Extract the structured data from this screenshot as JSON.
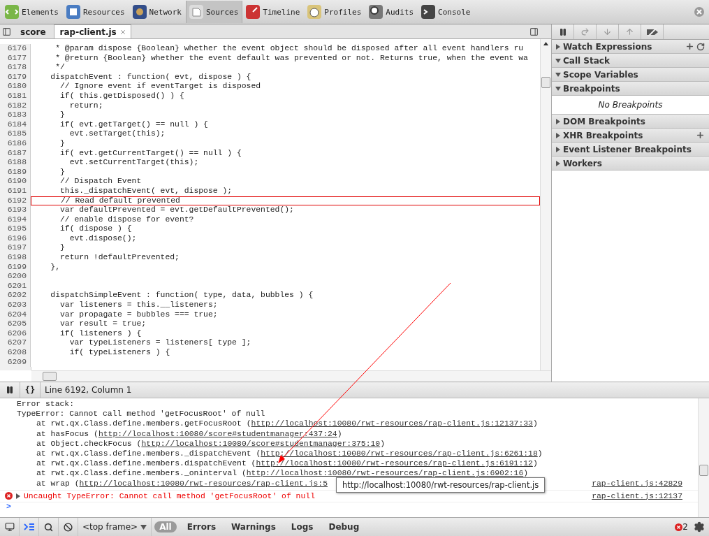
{
  "toolbar": {
    "tabs": [
      {
        "label": "Elements",
        "selected": false
      },
      {
        "label": "Resources",
        "selected": false
      },
      {
        "label": "Network",
        "selected": false
      },
      {
        "label": "Sources",
        "selected": true
      },
      {
        "label": "Timeline",
        "selected": false
      },
      {
        "label": "Profiles",
        "selected": false
      },
      {
        "label": "Audits",
        "selected": false
      },
      {
        "label": "Console",
        "selected": false
      }
    ]
  },
  "editor": {
    "file_tabs": [
      {
        "label": "score",
        "selected": false
      },
      {
        "label": "rap-client.js",
        "selected": true
      }
    ],
    "lines": [
      {
        "number": "6176",
        "text": "     * @param dispose {Boolean} whether the event object should be disposed after all event handlers ru",
        "highlighted": false
      },
      {
        "number": "6177",
        "text": "     * @return {Boolean} whether the event default was prevented or not. Returns true, when the event wa",
        "highlighted": false
      },
      {
        "number": "6178",
        "text": "     */",
        "highlighted": false
      },
      {
        "number": "6179",
        "text": "    dispatchEvent : function( evt, dispose ) {",
        "highlighted": false
      },
      {
        "number": "6180",
        "text": "      // Ignore event if eventTarget is disposed",
        "highlighted": false
      },
      {
        "number": "6181",
        "text": "      if( this.getDisposed() ) {",
        "highlighted": false
      },
      {
        "number": "6182",
        "text": "        return;",
        "highlighted": false
      },
      {
        "number": "6183",
        "text": "      }",
        "highlighted": false
      },
      {
        "number": "6184",
        "text": "      if( evt.getTarget() == null ) {",
        "highlighted": false
      },
      {
        "number": "6185",
        "text": "        evt.setTarget(this);",
        "highlighted": false
      },
      {
        "number": "6186",
        "text": "      }",
        "highlighted": false
      },
      {
        "number": "6187",
        "text": "      if( evt.getCurrentTarget() == null ) {",
        "highlighted": false
      },
      {
        "number": "6188",
        "text": "        evt.setCurrentTarget(this);",
        "highlighted": false
      },
      {
        "number": "6189",
        "text": "      }",
        "highlighted": false
      },
      {
        "number": "6190",
        "text": "      // Dispatch Event",
        "highlighted": false
      },
      {
        "number": "6191",
        "text": "      this._dispatchEvent( evt, dispose );",
        "highlighted": false
      },
      {
        "number": "6192",
        "text": "      // Read default prevented",
        "highlighted": true
      },
      {
        "number": "6193",
        "text": "      var defaultPrevented = evt.getDefaultPrevented();",
        "highlighted": false
      },
      {
        "number": "6194",
        "text": "      // enable dispose for event?",
        "highlighted": false
      },
      {
        "number": "6195",
        "text": "      if( dispose ) {",
        "highlighted": false
      },
      {
        "number": "6196",
        "text": "        evt.dispose();",
        "highlighted": false
      },
      {
        "number": "6197",
        "text": "      }",
        "highlighted": false
      },
      {
        "number": "6198",
        "text": "      return !defaultPrevented;",
        "highlighted": false
      },
      {
        "number": "6199",
        "text": "    },",
        "highlighted": false
      },
      {
        "number": "6200",
        "highlighted": false
      },
      {
        "number": "6201",
        "highlighted": false
      },
      {
        "number": "6202",
        "text": "    dispatchSimpleEvent : function( type, data, bubbles ) {",
        "highlighted": false
      },
      {
        "number": "6203",
        "text": "      var listeners = this.__listeners;",
        "highlighted": false
      },
      {
        "number": "6204",
        "text": "      var propagate = bubbles === true;",
        "highlighted": false
      },
      {
        "number": "6205",
        "text": "      var result = true;",
        "highlighted": false
      },
      {
        "number": "6206",
        "text": "      if( listeners ) {",
        "highlighted": false
      },
      {
        "number": "6207",
        "text": "        var typeListeners = listeners[ type ];",
        "highlighted": false
      },
      {
        "number": "6208",
        "text": "        if( typeListeners ) {",
        "highlighted": false
      },
      {
        "number": "6209",
        "highlighted": false
      }
    ]
  },
  "sidebar": {
    "sections": [
      {
        "title": "Watch Expressions",
        "expanded": false,
        "tools": [
          {
            "kind": "add"
          },
          {
            "kind": "refresh"
          }
        ]
      },
      {
        "title": "Call Stack",
        "expanded": true
      },
      {
        "title": "Scope Variables",
        "expanded": true
      },
      {
        "title": "Breakpoints",
        "expanded": true,
        "empty_text": "No Breakpoints"
      },
      {
        "title": "DOM Breakpoints",
        "expanded": false
      },
      {
        "title": "XHR Breakpoints",
        "expanded": false,
        "tools": [
          {
            "kind": "add"
          }
        ]
      },
      {
        "title": "Event Listener Breakpoints",
        "expanded": false
      },
      {
        "title": "Workers",
        "expanded": false
      }
    ]
  },
  "status_bar": {
    "pretty_print": "{}",
    "position": "Line 6192, Column 1"
  },
  "console": {
    "stack_title": "Error stack:",
    "error_line": "TypeError: Cannot call method 'getFocusRoot' of null",
    "frames": [
      {
        "text": "at rwt.qx.Class.define.members.getFocusRoot (",
        "link": "http://localhost:10080/rwt-resources/rap-client.js:12137:33",
        "after": ")"
      },
      {
        "text": "at hasFocus (",
        "link": "http://localhost:10080/score#studentmanager:437:24",
        "after": ")"
      },
      {
        "text": "at Object.checkFocus (",
        "link": "http://localhost:10080/score#studentmanager:375:10",
        "after": ")"
      },
      {
        "text": "at rwt.qx.Class.define.members._dispatchEvent (",
        "link": "http://localhost:10080/rwt-resources/rap-client.js:6261:18",
        "after": ")"
      },
      {
        "text": "at rwt.qx.Class.define.members.dispatchEvent (",
        "link": "http://localhost:10080/rwt-resources/rap-client.js:6191:12",
        "after": ")"
      },
      {
        "text": "at rwt.qx.Class.define.members._oninterval (",
        "link": "http://localhost:10080/rwt-resources/rap-client.js:6902:16",
        "after": ")"
      },
      {
        "text": "at wrap (",
        "link": "http://localhost:10080/rwt-resources/rap-client.js:5"
      }
    ],
    "source": "rap-client.js:42829",
    "error": {
      "text": "Uncaught TypeError: Cannot call method 'getFocusRoot' of null",
      "source": "rap-client.js:12137",
      "expanded": false
    },
    "prompt": ">",
    "tooltip": "http://localhost:10080/rwt-resources/rap-client.js"
  },
  "bottom_bar": {
    "frame": "<top frame>",
    "filters": [
      {
        "label": "All",
        "selected": true
      },
      {
        "label": "Errors",
        "selected": false
      },
      {
        "label": "Warnings",
        "selected": false
      },
      {
        "label": "Logs",
        "selected": false
      },
      {
        "label": "Debug",
        "selected": false
      }
    ],
    "error_count": "2"
  }
}
